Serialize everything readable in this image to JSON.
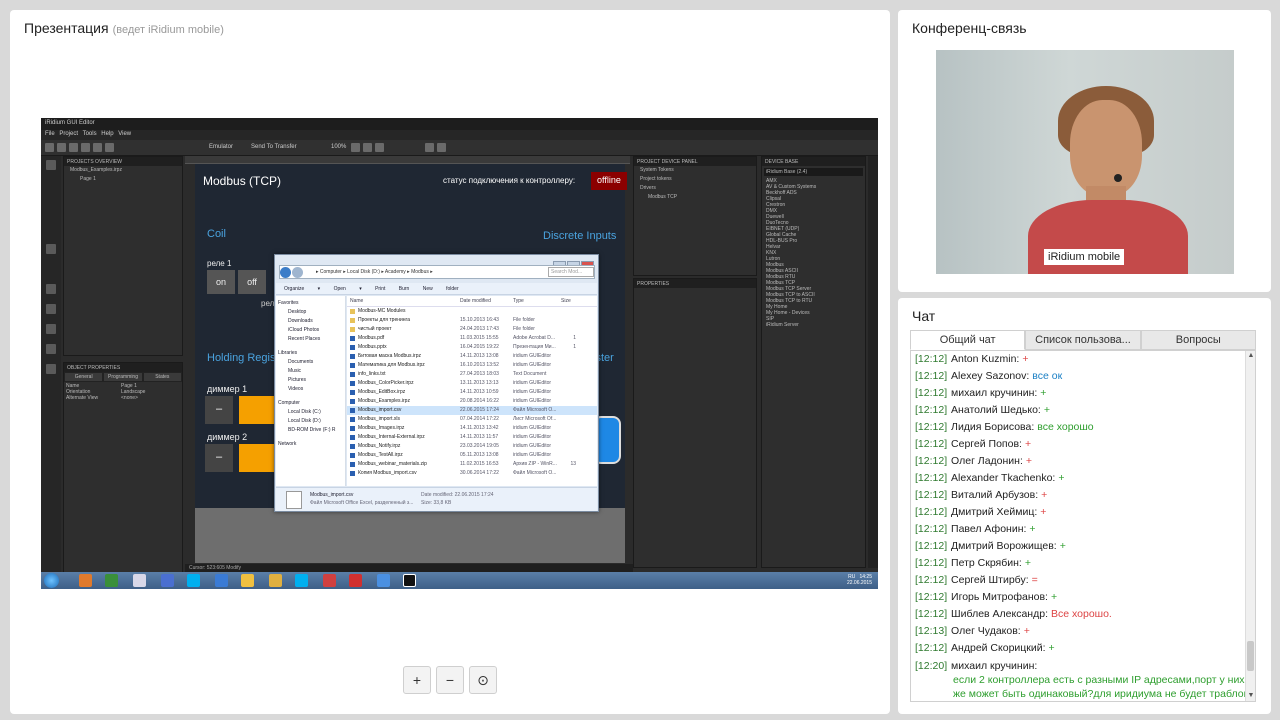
{
  "presentation": {
    "title": "Презентация",
    "subtitle": "(ведет iRidium mobile)",
    "editor": {
      "window_title": "iRidium GUI Editor",
      "menu": "File  Project  Tools  Help  View",
      "emulator_label": "Emulator",
      "send_label": "Send To Transfer",
      "zoom": "100%",
      "projects_overview": "PROJECTS OVERVIEW",
      "project_file": "Modbus_Examples.irpz",
      "page_item": "Page 1",
      "object_properties": "OBJECT PROPERTIES",
      "prop_tabs": [
        "General",
        "Programming",
        "States"
      ],
      "props": [
        {
          "k": "Name",
          "v": "Page 1"
        },
        {
          "k": "Orientation",
          "v": "Landscape"
        },
        {
          "k": "Alternate View",
          "v": "<none>"
        }
      ],
      "project_device_panel": "PROJECT DEVICE PANEL",
      "pdp_items": [
        "System Tokens",
        "Project tokens",
        "Drivers",
        "Modbus TCP"
      ],
      "properties": "PROPERTIES",
      "device_base": "DEVICE BASE",
      "device_base_select": "iRidium Base (2.4)",
      "db_items": [
        "AMX",
        "AV & Custom Systems",
        "Beckhoff ADS",
        "Clipsal",
        "Crestron",
        "DMX",
        "Duewell",
        "DuoTecno",
        "EIBNET (UDP)",
        "Global Cache",
        "HDL-BUS Pro",
        "Helvar",
        "KNX",
        "Lutron",
        "Modbus",
        "Modbus ASCII",
        "Modbus RTU",
        "Modbus TCP",
        "Modbus TCP Server",
        "Modbus TCP to ASCII",
        "Modbus TCP to RTU",
        "My Home",
        "My Home - Devices",
        "SIP",
        "iRidium Server"
      ],
      "status_bar": "Cursor: 523:605        Modify",
      "tray_lang": "RU",
      "tray_time": "14:25",
      "tray_date": "22.06.2015"
    },
    "canvas": {
      "title": "Modbus (TCP)",
      "status_label": "статус подключения к контроллеру:",
      "status_value": "offline",
      "coil": "Coil",
      "discrete": "Discrete Inputs",
      "rele": "реле 1",
      "btn_on": "on",
      "btn_off": "off",
      "rele_partial": "рел",
      "holding": "Holding Regis",
      "ister": "ister",
      "dimmer1": "диммер 1",
      "dimmer2": "диммер 2",
      "minus": "–"
    },
    "explorer": {
      "address": "▸ Computer ▸ Local Disk (D:) ▸ Academy ▸ Modbus ▸",
      "search_placeholder": "Search Mod...",
      "toolbar": "Organize ▾  Open ▾  Print  Burn  New folder",
      "nav": {
        "favorites": "Favorites",
        "fav_items": [
          "Desktop",
          "Downloads",
          "iCloud Photos",
          "Recent Places"
        ],
        "libraries": "Libraries",
        "lib_items": [
          "Documents",
          "Music",
          "Pictures",
          "Videos"
        ],
        "computer": "Computer",
        "comp_items": [
          "Local Disk (C:)",
          "Local Disk (D:)",
          "BD-ROM Drive (F:) R"
        ],
        "network": "Network"
      },
      "columns": {
        "name": "Name",
        "date": "Date modified",
        "type": "Type",
        "size": "Size"
      },
      "files": [
        {
          "name": "Modbus-MC Modules",
          "date": "",
          "type": "",
          "size": "",
          "folder": true
        },
        {
          "name": "Проекты для тренинга",
          "date": "15.10.2013 16:43",
          "type": "File folder",
          "size": "",
          "folder": true
        },
        {
          "name": "чистый проект",
          "date": "24.04.2013 17:43",
          "type": "File folder",
          "size": "",
          "folder": true
        },
        {
          "name": "Modbus.pdf",
          "date": "11.03.2015 15:55",
          "type": "Adobe Acrobat D...",
          "size": "1",
          "folder": false
        },
        {
          "name": "Modbus.pptx",
          "date": "16.04.2015 19:22",
          "type": "Презентация Ми...",
          "size": "1",
          "folder": false
        },
        {
          "name": "Битовая маска Modbus.irpz",
          "date": "14.11.2013 13:08",
          "type": "iridium GUIEditor",
          "size": "",
          "folder": false
        },
        {
          "name": "Математика для Modbus.irpz",
          "date": "16.10.2013 13:52",
          "type": "iridium GUIEditor",
          "size": "",
          "folder": false
        },
        {
          "name": "info_links.txt",
          "date": "27.04.2013 18:03",
          "type": "Text Document",
          "size": "",
          "folder": false
        },
        {
          "name": "Modbus_ColorPicker.irpz",
          "date": "13.11.2013 13:13",
          "type": "iridium GUIEditor",
          "size": "",
          "folder": false
        },
        {
          "name": "Modbus_EditBox.irpz",
          "date": "14.11.2013 10:59",
          "type": "iridium GUIEditor",
          "size": "",
          "folder": false
        },
        {
          "name": "Modbus_Examples.irpz",
          "date": "20.08.2014 16:22",
          "type": "iridium GUIEditor",
          "size": "",
          "folder": false
        },
        {
          "name": "Modbus_import.csv",
          "date": "22.06.2015 17:24",
          "type": "Файл Microsoft O...",
          "size": "",
          "folder": false,
          "selected": true
        },
        {
          "name": "Modbus_import.xls",
          "date": "07.04.2014 17:22",
          "type": "Лист Microsoft Of...",
          "size": "",
          "folder": false
        },
        {
          "name": "Modbus_Images.irpz",
          "date": "14.11.2013 13:42",
          "type": "iridium GUIEditor",
          "size": "",
          "folder": false
        },
        {
          "name": "Modbus_Internal-External.irpz",
          "date": "14.11.2013 11:57",
          "type": "iridium GUIEditor",
          "size": "",
          "folder": false
        },
        {
          "name": "Modbus_Notify.irpz",
          "date": "23.03.2014 19:05",
          "type": "iridium GUIEditor",
          "size": "",
          "folder": false
        },
        {
          "name": "Modbus_TestAll.irpz",
          "date": "05.11.2013 13:08",
          "type": "iridium GUIEditor",
          "size": "",
          "folder": false
        },
        {
          "name": "Modbus_webinar_materials.zip",
          "date": "11.02.2015 16:53",
          "type": "Архив ZIP - WinR...",
          "size": "13",
          "folder": false
        },
        {
          "name": "Копия Modbus_import.csv",
          "date": "30.06.2014 17:22",
          "type": "Файл Microsoft O...",
          "size": "",
          "folder": false
        }
      ],
      "detail": {
        "name": "Modbus_import.csv",
        "type": "Файл Microsoft Office Excel, разделенный з...",
        "modified": "Date modified: 22.06.2015 17:24",
        "size": "Size: 33,8 KB"
      }
    },
    "zoom_in": "+",
    "zoom_out": "−",
    "zoom_fit": "⊙"
  },
  "conference": {
    "title": "Конференц-связь",
    "video_label": "iRidium mobile"
  },
  "chat": {
    "title": "Чат",
    "tabs": [
      "Общий чат",
      "Список пользова...",
      "Вопросы"
    ],
    "messages": [
      {
        "time": "[12:12]",
        "user": "Anton Kuzmin:",
        "text": "+",
        "color": "red"
      },
      {
        "time": "[12:12]",
        "user": "Alexey Sazonov:",
        "text": "все ок",
        "color": "blue"
      },
      {
        "time": "[12:12]",
        "user": "михаил кручинин:",
        "text": "+",
        "color": "green"
      },
      {
        "time": "[12:12]",
        "user": "Анатолий Шедько:",
        "text": "+",
        "color": "green"
      },
      {
        "time": "[12:12]",
        "user": "Лидия Борисова:",
        "text": "все хорошо",
        "color": "green"
      },
      {
        "time": "[12:12]",
        "user": "Сергей Попов:",
        "text": "+",
        "color": "red"
      },
      {
        "time": "[12:12]",
        "user": "Олег Ладонин:",
        "text": "+",
        "color": "red"
      },
      {
        "time": "[12:12]",
        "user": "Alexander Tkachenko:",
        "text": "+",
        "color": "green"
      },
      {
        "time": "[12:12]",
        "user": "Виталий Арбузов:",
        "text": "+",
        "color": "red"
      },
      {
        "time": "[12:12]",
        "user": "Дмитрий Хеймиц:",
        "text": "+",
        "color": "red"
      },
      {
        "time": "[12:12]",
        "user": "Павел Афонин:",
        "text": "+",
        "color": "green"
      },
      {
        "time": "[12:12]",
        "user": "Дмитрий Ворожищев:",
        "text": "+",
        "color": "green"
      },
      {
        "time": "[12:12]",
        "user": "Петр Скрябин:",
        "text": "+",
        "color": "green"
      },
      {
        "time": "[12:12]",
        "user": "Сергей Штирбу:",
        "text": "=",
        "color": "red"
      },
      {
        "time": "[12:12]",
        "user": "Игорь Митрофанов:",
        "text": "+",
        "color": "green"
      },
      {
        "time": "[12:12]",
        "user": "Шиблев Александр:",
        "text": "Все хорошо.",
        "color": "red"
      },
      {
        "time": "[12:13]",
        "user": "Олег Чудаков:",
        "text": "+",
        "color": "red"
      },
      {
        "time": "[12:12]",
        "user": "Андрей Скорицкий:",
        "text": "+",
        "color": "green"
      },
      {
        "time": "[12:20]",
        "user": "михаил кручинин:",
        "text": "если 2 контроллера есть с разными IP адресами,порт у них же может быть одинаковый?для иридиума не будет траблов?",
        "color": "green",
        "multi": true
      }
    ]
  },
  "colors": {
    "chat_time": "#2f7a2f",
    "chat_green": "#2e9e2e",
    "chat_blue": "#1a7fc4",
    "chat_red": "#d44444",
    "offline_bg": "#8b0000",
    "accent_blue": "#4aa3df",
    "dimmer_orange": "#f5a000"
  }
}
